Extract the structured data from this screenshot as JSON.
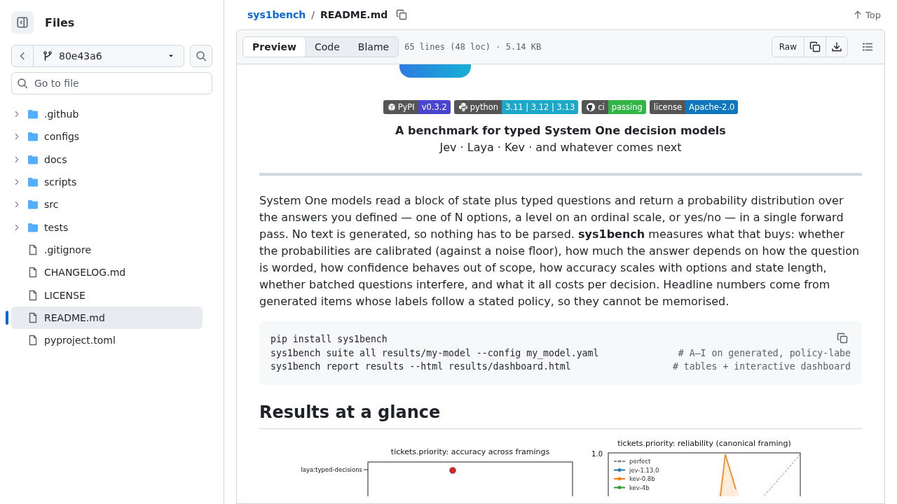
{
  "sidebar": {
    "title": "Files",
    "branch": "80e43a6",
    "search": {
      "placeholder": "Go to file"
    },
    "tree": [
      {
        "kind": "folder",
        "name": ".github",
        "expanded": false,
        "selected": false
      },
      {
        "kind": "folder",
        "name": "configs",
        "expanded": false,
        "selected": false
      },
      {
        "kind": "folder",
        "name": "docs",
        "expanded": false,
        "selected": false
      },
      {
        "kind": "folder",
        "name": "scripts",
        "expanded": false,
        "selected": false
      },
      {
        "kind": "folder",
        "name": "src",
        "expanded": false,
        "selected": false
      },
      {
        "kind": "folder",
        "name": "tests",
        "expanded": false,
        "selected": false
      },
      {
        "kind": "file",
        "name": ".gitignore",
        "selected": false
      },
      {
        "kind": "file",
        "name": "CHANGELOG.md",
        "selected": false
      },
      {
        "kind": "file",
        "name": "LICENSE",
        "selected": false
      },
      {
        "kind": "file",
        "name": "README.md",
        "selected": true
      },
      {
        "kind": "file",
        "name": "pyproject.toml",
        "selected": false
      }
    ]
  },
  "file_header": {
    "repo": "sys1bench",
    "separator": "/",
    "file": "README.md",
    "top": "Top"
  },
  "toolbar": {
    "tabs": [
      {
        "label": "Preview",
        "selected": true
      },
      {
        "label": "Code",
        "selected": false
      },
      {
        "label": "Blame",
        "selected": false
      }
    ],
    "info": "65 lines (48 loc) · 5.14 KB",
    "raw": "Raw"
  },
  "readme": {
    "badges": [
      {
        "kind": "pypi",
        "label": "PyPI",
        "message": "v0.3.2",
        "color": "#4a45d1"
      },
      {
        "kind": "python",
        "label": "python",
        "message": "3.11 | 3.12 | 3.13",
        "color": "#1ca9c9"
      },
      {
        "kind": "github",
        "label": "ci",
        "message": "passing",
        "color": "#31b646"
      },
      {
        "kind": "plain",
        "label": "license",
        "message": "Apache-2.0",
        "color": "#0f77bd"
      }
    ],
    "title": "A benchmark for typed System One decision models",
    "subtitle": "Jev · Laya · Kev · and whatever comes next",
    "paragraph": "System One models read a block of state plus typed questions and return a probability distribution over the answers you defined — one of N options, a level on an ordinal scale, or yes/no — in a single forward pass. No text is generated, so nothing has to be parsed. **sys1bench** measures what that buys: whether the probabilities are calibrated (against a noise floor), how much the answer depends on how the question is worded, how confidence behaves out of scope, how accuracy scales with options and state length, whether batched questions interfere, and what it all costs per decision. Headline numbers come from generated items whose labels follow a stated policy, so they cannot be memorised.",
    "code": [
      {
        "command": "pip install sys1bench"
      },
      {
        "command": "sys1bench suite all results/my-model --config my_model.yaml",
        "comment": "# A–I on generated, policy-labe"
      },
      {
        "command": "sys1bench report results --html results/dashboard.html",
        "comment": "# tables + interactive dashboard"
      }
    ],
    "heading": "Results at a glance",
    "charts": [
      {
        "kind": "dots",
        "title": "tickets.priority: accuracy across framings",
        "row_label": "laya:typed-decisions"
      },
      {
        "kind": "reliability",
        "title": "tickets.priority: reliability (canonical framing)",
        "y_tick": "1.0",
        "legend": [
          {
            "label": "perfect",
            "color": "#888888",
            "dashed": true
          },
          {
            "label": "jev-1.13.0",
            "color": "#1f77b4",
            "dashed": false
          },
          {
            "label": "kev-0.8b",
            "color": "#ff7f0e",
            "dashed": false
          },
          {
            "label": "kev-4b",
            "color": "#2ca02c",
            "dashed": false
          }
        ]
      }
    ]
  }
}
